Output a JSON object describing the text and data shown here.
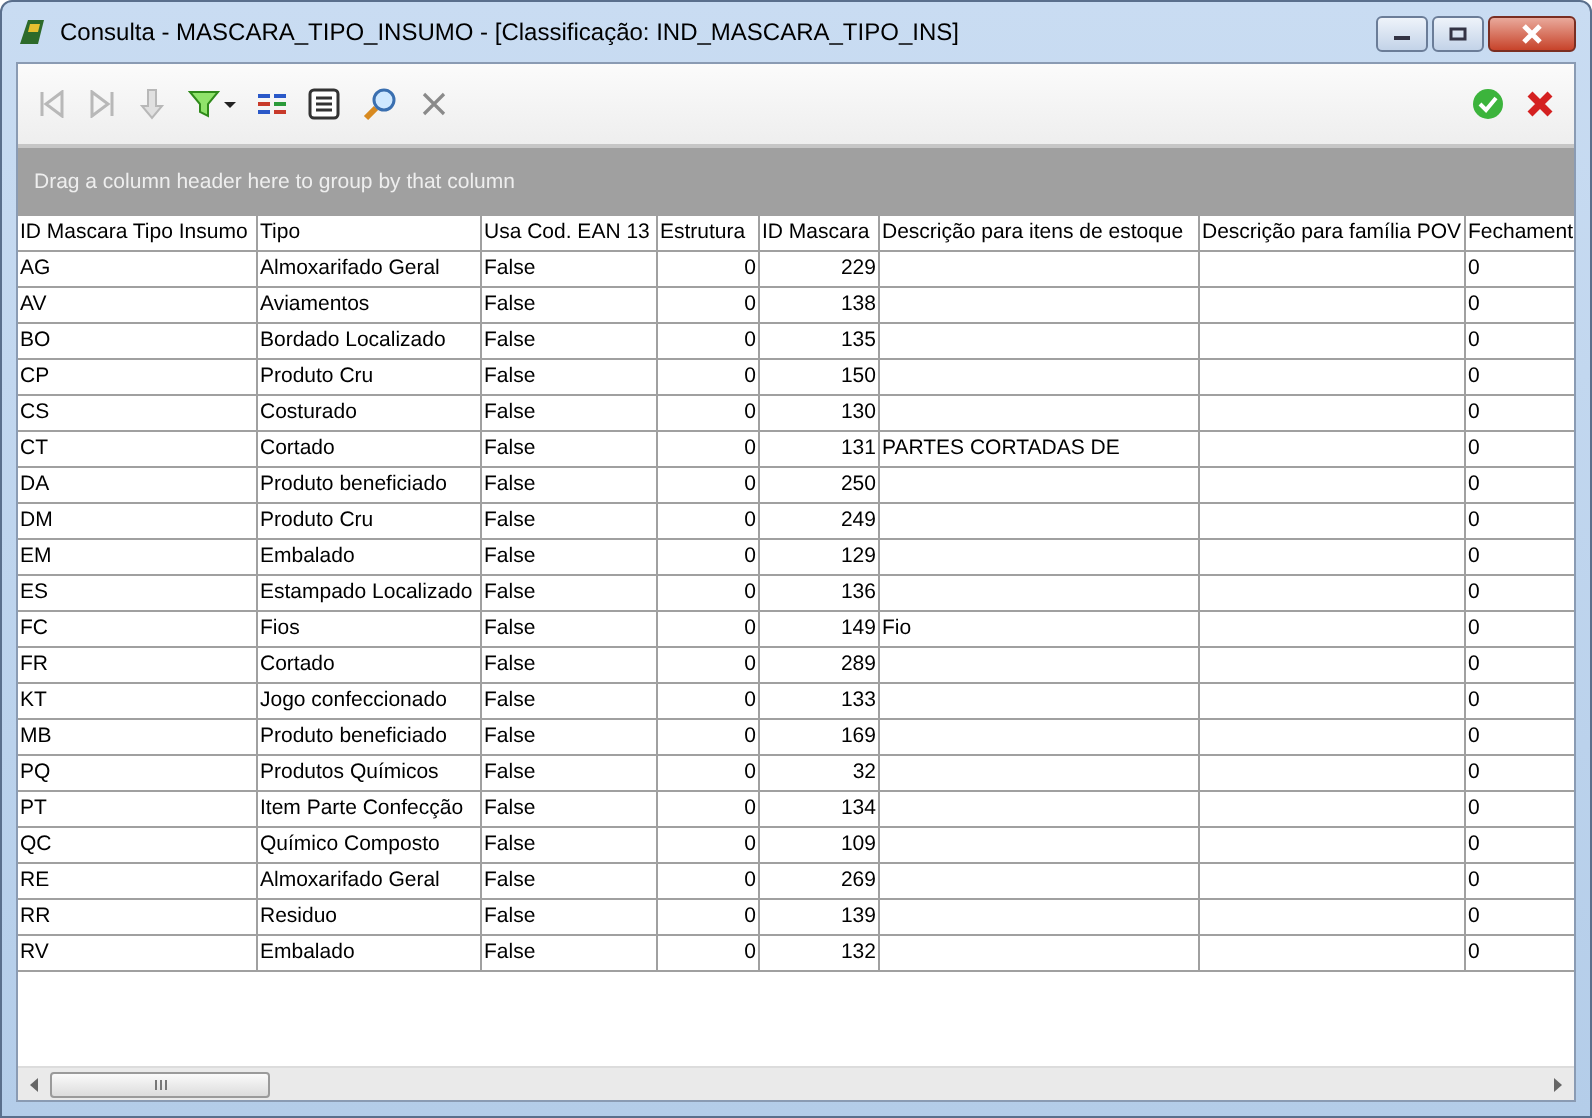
{
  "window": {
    "title": "Consulta - MASCARA_TIPO_INSUMO - [Classificação: IND_MASCARA_TIPO_INS]"
  },
  "toolbar": [
    {
      "kind": "first",
      "disabled": true
    },
    {
      "kind": "last",
      "disabled": true
    },
    {
      "kind": "down",
      "disabled": true
    },
    {
      "kind": "filter",
      "disabled": false
    },
    {
      "kind": "columns",
      "disabled": false
    },
    {
      "kind": "list",
      "disabled": false
    },
    {
      "kind": "search",
      "disabled": false
    },
    {
      "kind": "clear",
      "disabled": true
    }
  ],
  "actions": [
    {
      "kind": "confirm"
    },
    {
      "kind": "cancel"
    }
  ],
  "group_panel": {
    "hint": "Drag a column header here to group by that column"
  },
  "table": {
    "columns": [
      "ID Mascara Tipo Insumo",
      "Tipo",
      "Usa Cod. EAN 13",
      "Estrutura",
      "ID Mascara",
      "Descrição para itens de estoque",
      "Descrição para família POV",
      "Fechament"
    ],
    "rows": [
      {
        "id": "AG",
        "tipo": "Almoxarifado Geral",
        "ean": "False",
        "estrutura": "0",
        "id_mascara": "229",
        "fechamento": "0"
      },
      {
        "id": "AV",
        "tipo": "Aviamentos",
        "ean": "False",
        "estrutura": "0",
        "id_mascara": "138",
        "fechamento": "0"
      },
      {
        "id": "BO",
        "tipo": "Bordado Localizado",
        "ean": "False",
        "estrutura": "0",
        "id_mascara": "135",
        "fechamento": "0"
      },
      {
        "id": "CP",
        "tipo": "Produto Cru",
        "ean": "False",
        "estrutura": "0",
        "id_mascara": "150",
        "fechamento": "0"
      },
      {
        "id": "CS",
        "tipo": "Costurado",
        "ean": "False",
        "estrutura": "0",
        "id_mascara": "130",
        "fechamento": "0"
      },
      {
        "id": "CT",
        "tipo": "Cortado",
        "ean": "False",
        "estrutura": "0",
        "id_mascara": "131",
        "desc_estoque": "PARTES CORTADAS DE",
        "fechamento": "0"
      },
      {
        "id": "DA",
        "tipo": "Produto beneficiado",
        "ean": "False",
        "estrutura": "0",
        "id_mascara": "250",
        "fechamento": "0"
      },
      {
        "id": "DM",
        "tipo": "Produto Cru",
        "ean": "False",
        "estrutura": "0",
        "id_mascara": "249",
        "fechamento": "0"
      },
      {
        "id": "EM",
        "tipo": "Embalado",
        "ean": "False",
        "estrutura": "0",
        "id_mascara": "129",
        "fechamento": "0"
      },
      {
        "id": "ES",
        "tipo": "Estampado Localizado",
        "ean": "False",
        "estrutura": "0",
        "id_mascara": "136",
        "fechamento": "0"
      },
      {
        "id": "FC",
        "tipo": "Fios",
        "ean": "False",
        "estrutura": "0",
        "id_mascara": "149",
        "desc_estoque": "Fio",
        "fechamento": "0"
      },
      {
        "id": "FR",
        "tipo": "Cortado",
        "ean": "False",
        "estrutura": "0",
        "id_mascara": "289",
        "fechamento": "0"
      },
      {
        "id": "KT",
        "tipo": "Jogo confeccionado",
        "ean": "False",
        "estrutura": "0",
        "id_mascara": "133",
        "fechamento": "0"
      },
      {
        "id": "MB",
        "tipo": "Produto beneficiado",
        "ean": "False",
        "estrutura": "0",
        "id_mascara": "169",
        "fechamento": "0"
      },
      {
        "id": "PQ",
        "tipo": "Produtos Químicos",
        "ean": "False",
        "estrutura": "0",
        "id_mascara": "32",
        "fechamento": "0"
      },
      {
        "id": "PT",
        "tipo": "Item Parte Confecção",
        "ean": "False",
        "estrutura": "0",
        "id_mascara": "134",
        "fechamento": "0"
      },
      {
        "id": "QC",
        "tipo": "Químico Composto",
        "ean": "False",
        "estrutura": "0",
        "id_mascara": "109",
        "fechamento": "0"
      },
      {
        "id": "RE",
        "tipo": "Almoxarifado Geral",
        "ean": "False",
        "estrutura": "0",
        "id_mascara": "269",
        "fechamento": "0"
      },
      {
        "id": "RR",
        "tipo": "Residuo",
        "ean": "False",
        "estrutura": "0",
        "id_mascara": "139",
        "fechamento": "0"
      },
      {
        "id": "RV",
        "tipo": "Embalado",
        "ean": "False",
        "estrutura": "0",
        "id_mascara": "132",
        "fechamento": "0"
      }
    ]
  }
}
